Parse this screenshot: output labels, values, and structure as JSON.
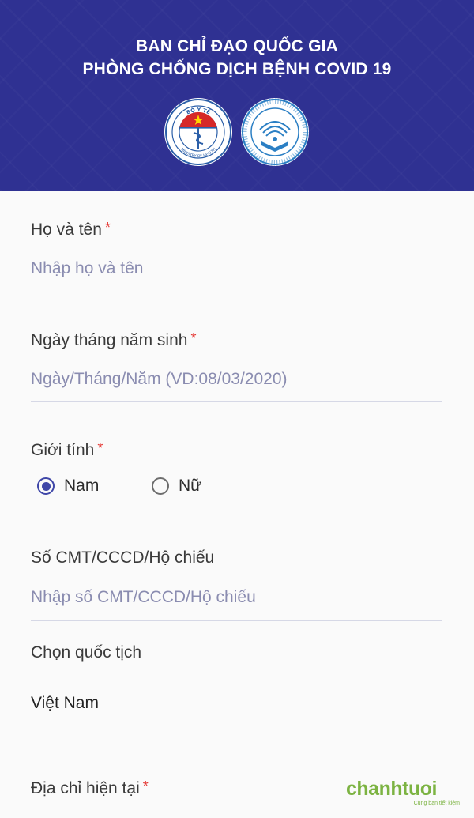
{
  "header": {
    "title_line1": "BAN CHỈ ĐẠO QUỐC GIA",
    "title_line2": "PHÒNG CHỐNG DỊCH BỆNH COVID 19",
    "logo_moh": {
      "icon": "ministry-of-health-logo",
      "text_top": "BỘ Y TẾ",
      "text_bottom": "MINISTRY OF HEALTH"
    },
    "logo_mic": {
      "icon": "ministry-of-information-logo"
    },
    "background_color": "#2f3192"
  },
  "form": {
    "full_name": {
      "label": "Họ và tên",
      "required_mark": "*",
      "placeholder": "Nhập họ và tên",
      "value": ""
    },
    "birth_date": {
      "label": "Ngày tháng năm sinh",
      "required_mark": "*",
      "placeholder": "Ngày/Tháng/Năm (VD:08/03/2020)",
      "value": ""
    },
    "gender": {
      "label": "Giới tính",
      "required_mark": "*",
      "options": [
        {
          "label": "Nam",
          "selected": true
        },
        {
          "label": "Nữ",
          "selected": false
        }
      ]
    },
    "id_number": {
      "label": "Số CMT/CCCD/Hộ chiếu",
      "placeholder": "Nhập số CMT/CCCD/Hộ chiếu",
      "value": ""
    },
    "nationality": {
      "label": "Chọn quốc tịch",
      "value": "Việt Nam"
    },
    "current_address": {
      "label": "Địa chỉ hiện tại",
      "required_mark": "*"
    }
  },
  "watermark": {
    "brand": "chanhtuoi",
    "tagline": "Cùng bạn tiết kiệm"
  },
  "colors": {
    "accent": "#3f47a8",
    "required": "#e53935",
    "placeholder": "#8a8cb0",
    "watermark": "#7cb342"
  }
}
